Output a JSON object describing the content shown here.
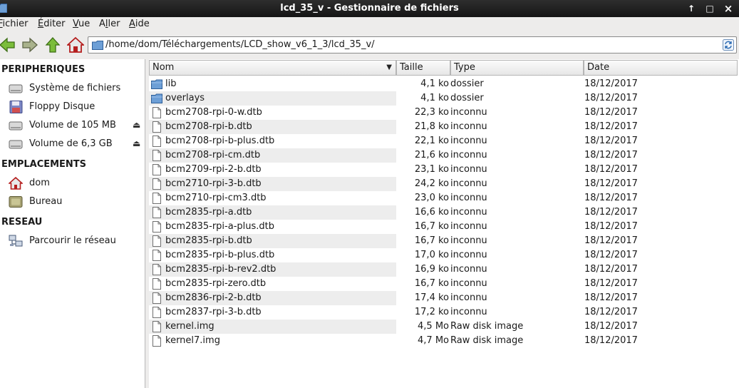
{
  "window": {
    "title": "lcd_35_v - Gestionnaire de fichiers",
    "buttons": {
      "maximize": "↑",
      "restore": "□",
      "close": "×"
    }
  },
  "menubar": {
    "items": [
      {
        "label": "Fichier",
        "mnemonic": "F"
      },
      {
        "label": "Éditer",
        "mnemonic": "É"
      },
      {
        "label": "Vue",
        "mnemonic": "V"
      },
      {
        "label": "Aller",
        "mnemonic": "l"
      },
      {
        "label": "Aide",
        "mnemonic": "A"
      }
    ]
  },
  "toolbar": {
    "icons": [
      "back-arrow-icon",
      "forward-arrow-icon",
      "up-arrow-icon",
      "home-icon"
    ],
    "location": "/home/dom/Téléchargements/LCD_show_v6_1_3/lcd_35_v/"
  },
  "sidebar": {
    "sections": [
      {
        "title": "PERIPHERIQUES",
        "items": [
          {
            "label": "Système de fichiers",
            "icon": "drive-icon",
            "eject": false
          },
          {
            "label": "Floppy Disque",
            "icon": "floppy-icon",
            "eject": false
          },
          {
            "label": "Volume de 105 MB",
            "icon": "drive-icon",
            "eject": true
          },
          {
            "label": "Volume de 6,3 GB",
            "icon": "drive-icon",
            "eject": true
          }
        ]
      },
      {
        "title": "EMPLACEMENTS",
        "items": [
          {
            "label": "dom",
            "icon": "home-icon",
            "eject": false
          },
          {
            "label": "Bureau",
            "icon": "desktop-icon",
            "eject": false
          }
        ]
      },
      {
        "title": "RESEAU",
        "items": [
          {
            "label": "Parcourir le réseau",
            "icon": "network-icon",
            "eject": false
          }
        ]
      }
    ],
    "eject_glyph": "⏏"
  },
  "filelist": {
    "columns": {
      "name": "Nom",
      "size": "Taille",
      "type": "Type",
      "date": "Date"
    },
    "sort_indicator": "▼",
    "rows": [
      {
        "name": "lib",
        "size": "4,1 ko",
        "type": "dossier",
        "date": "18/12/2017",
        "icon": "folder-icon"
      },
      {
        "name": "overlays",
        "size": "4,1 ko",
        "type": "dossier",
        "date": "18/12/2017",
        "icon": "folder-icon"
      },
      {
        "name": "bcm2708-rpi-0-w.dtb",
        "size": "22,3 ko",
        "type": "inconnu",
        "date": "18/12/2017",
        "icon": "file-icon"
      },
      {
        "name": "bcm2708-rpi-b.dtb",
        "size": "21,8 ko",
        "type": "inconnu",
        "date": "18/12/2017",
        "icon": "file-icon"
      },
      {
        "name": "bcm2708-rpi-b-plus.dtb",
        "size": "22,1 ko",
        "type": "inconnu",
        "date": "18/12/2017",
        "icon": "file-icon"
      },
      {
        "name": "bcm2708-rpi-cm.dtb",
        "size": "21,6 ko",
        "type": "inconnu",
        "date": "18/12/2017",
        "icon": "file-icon"
      },
      {
        "name": "bcm2709-rpi-2-b.dtb",
        "size": "23,1 ko",
        "type": "inconnu",
        "date": "18/12/2017",
        "icon": "file-icon"
      },
      {
        "name": "bcm2710-rpi-3-b.dtb",
        "size": "24,2 ko",
        "type": "inconnu",
        "date": "18/12/2017",
        "icon": "file-icon"
      },
      {
        "name": "bcm2710-rpi-cm3.dtb",
        "size": "23,0 ko",
        "type": "inconnu",
        "date": "18/12/2017",
        "icon": "file-icon"
      },
      {
        "name": "bcm2835-rpi-a.dtb",
        "size": "16,6 ko",
        "type": "inconnu",
        "date": "18/12/2017",
        "icon": "file-icon"
      },
      {
        "name": "bcm2835-rpi-a-plus.dtb",
        "size": "16,7 ko",
        "type": "inconnu",
        "date": "18/12/2017",
        "icon": "file-icon"
      },
      {
        "name": "bcm2835-rpi-b.dtb",
        "size": "16,7 ko",
        "type": "inconnu",
        "date": "18/12/2017",
        "icon": "file-icon"
      },
      {
        "name": "bcm2835-rpi-b-plus.dtb",
        "size": "17,0 ko",
        "type": "inconnu",
        "date": "18/12/2017",
        "icon": "file-icon"
      },
      {
        "name": "bcm2835-rpi-b-rev2.dtb",
        "size": "16,9 ko",
        "type": "inconnu",
        "date": "18/12/2017",
        "icon": "file-icon"
      },
      {
        "name": "bcm2835-rpi-zero.dtb",
        "size": "16,7 ko",
        "type": "inconnu",
        "date": "18/12/2017",
        "icon": "file-icon"
      },
      {
        "name": "bcm2836-rpi-2-b.dtb",
        "size": "17,4 ko",
        "type": "inconnu",
        "date": "18/12/2017",
        "icon": "file-icon"
      },
      {
        "name": "bcm2837-rpi-3-b.dtb",
        "size": "17,2 ko",
        "type": "inconnu",
        "date": "18/12/2017",
        "icon": "file-icon"
      },
      {
        "name": "kernel.img",
        "size": "4,5 Mo",
        "type": "Raw disk image",
        "date": "18/12/2017",
        "icon": "file-icon"
      },
      {
        "name": "kernel7.img",
        "size": "4,7 Mo",
        "type": "Raw disk image",
        "date": "18/12/2017",
        "icon": "file-icon"
      }
    ]
  }
}
